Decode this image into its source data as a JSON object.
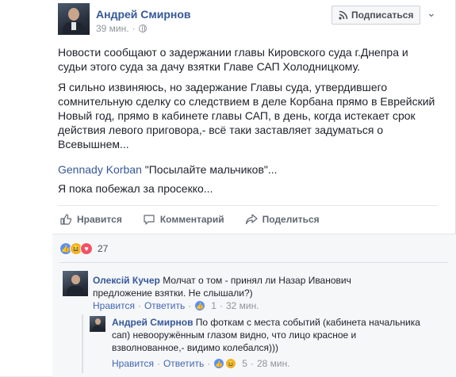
{
  "post": {
    "author": "Андрей Смирнов",
    "time": "39 мин.",
    "subscribe_label": "Подписаться",
    "paragraph1": "Новости сообщают о задержании главы Кировского суда г.Днепра и судьи этого суда за дачу взятки Главе САП Холодницкому.",
    "paragraph2": "Я сильно извиняюсь, но задержание Главы суда, утвердившего сомнительную сделку со следствием в деле Корбана прямо в Еврейский Новый год, прямо в кабинете главы САП, в день, когда истекает срок действия левого приговора,- всё таки заставляет задуматься о Всевышнем...",
    "mention_name": "Gennady Korban",
    "mention_quote": " \"Посылайте мальчиков\"...",
    "paragraph4": "Я пока побежал за просекко..."
  },
  "actions": {
    "like": "Нравится",
    "comment": "Комментарий",
    "share": "Поделиться"
  },
  "reactions": {
    "count": "27",
    "types": [
      "like",
      "haha",
      "love"
    ]
  },
  "comments": [
    {
      "author": "Олексій Кучер",
      "text": "Молчат о том - принял ли Назар Иванович предложение взятки. Не слышали?)",
      "like_label": "Нравится",
      "reply_label": "Ответить",
      "reaction_count": "1",
      "time": "32 мин."
    },
    {
      "author": "Андрей Смирнов",
      "text": "По фоткам с места событий (кабинета начальника сап) невооружённым глазом видно, что лицо красное и взволнованное,- видимо колебался)))",
      "like_label": "Нравится",
      "reply_label": "Ответить",
      "reaction_count": "5",
      "time": "28 мин."
    }
  ],
  "colors": {
    "link": "#365899",
    "like_blue": "#5890ff",
    "haha_yellow": "#f7b125",
    "love_red": "#f25268"
  },
  "icons": [
    "rss-icon",
    "chevron-down-icon",
    "globe-icon",
    "like-icon",
    "comment-icon",
    "share-icon"
  ]
}
